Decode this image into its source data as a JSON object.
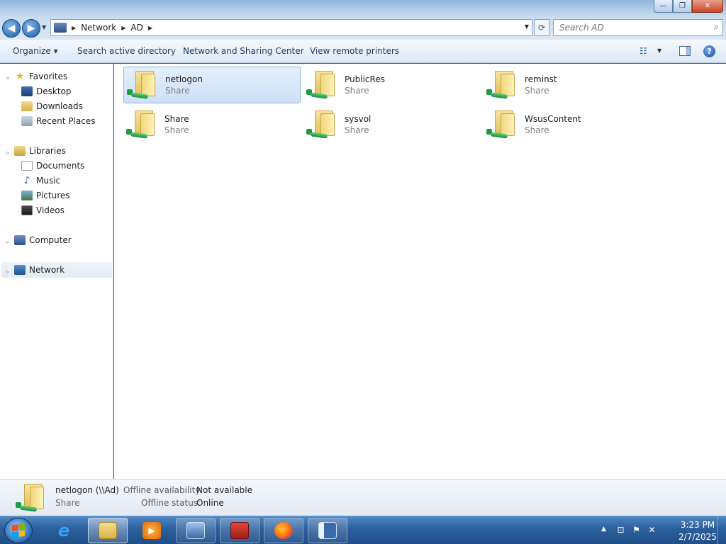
{
  "window": {
    "minimize": "—",
    "maximize": "❐",
    "close": "✕"
  },
  "address": {
    "crumbs": [
      "Network",
      "AD"
    ],
    "search_placeholder": "Search AD"
  },
  "toolbar": {
    "organize": "Organize ▾",
    "search_ad": "Search active directory",
    "network_sharing": "Network and Sharing Center",
    "view_printers": "View remote printers"
  },
  "nav": {
    "favorites": "Favorites",
    "desktop": "Desktop",
    "downloads": "Downloads",
    "recent_places": "Recent Places",
    "libraries": "Libraries",
    "documents": "Documents",
    "music": "Music",
    "pictures": "Pictures",
    "videos": "Videos",
    "computer": "Computer",
    "network": "Network"
  },
  "shares": [
    {
      "name": "netlogon",
      "type": "Share"
    },
    {
      "name": "PublicRes",
      "type": "Share"
    },
    {
      "name": "reminst",
      "type": "Share"
    },
    {
      "name": "Share",
      "type": "Share"
    },
    {
      "name": "sysvol",
      "type": "Share"
    },
    {
      "name": "WsusContent",
      "type": "Share"
    }
  ],
  "details": {
    "name": "netlogon (\\\\Ad)",
    "type": "Share",
    "offline_availability_label": "Offline availability:",
    "offline_availability_value": "Not available",
    "offline_status_label": "Offline status:",
    "offline_status_value": "Online"
  },
  "taskbar": {
    "time": "3:23 PM",
    "date": "2/7/2025"
  },
  "colors": {
    "accent": "#2a5d9a",
    "selection": "#cde0f6"
  }
}
